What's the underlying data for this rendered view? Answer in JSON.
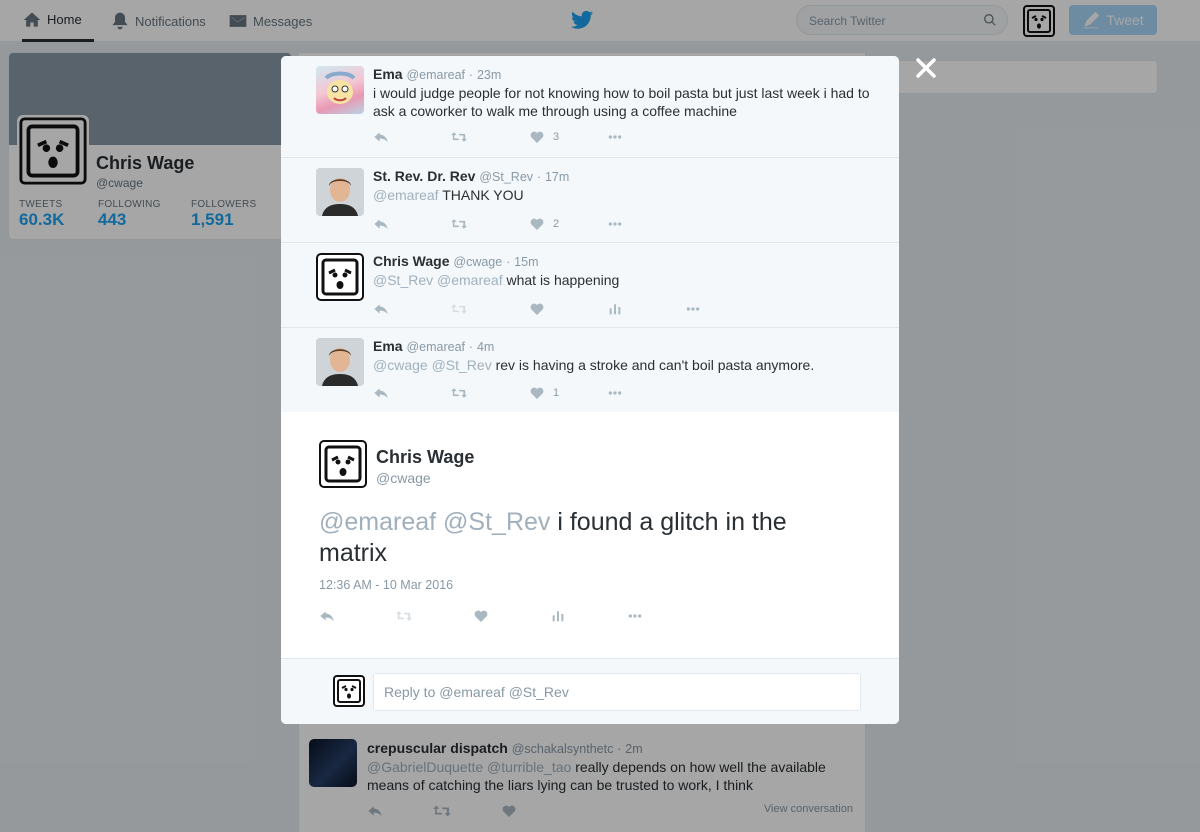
{
  "nav": {
    "home": "Home",
    "notifications": "Notifications",
    "messages": "Messages",
    "search_placeholder": "Search Twitter",
    "tweet_button": "Tweet"
  },
  "profile": {
    "name": "Chris Wage",
    "handle": "@cwage",
    "stats": [
      {
        "label": "TWEETS",
        "value": "60.3K"
      },
      {
        "label": "FOLLOWING",
        "value": "443"
      },
      {
        "label": "FOLLOWERS",
        "value": "1,591"
      }
    ]
  },
  "conversation": [
    {
      "name": "Ema",
      "handle": "@emareaf",
      "time": "23m",
      "mentions": "",
      "text": "i would judge people for not knowing how to boil pasta but just last  week i had to ask a coworker to walk me through using a coffee machine",
      "like_count": "3"
    },
    {
      "name": "St. Rev. Dr. Rev",
      "handle": "@St_Rev",
      "time": "17m",
      "mentions": "@emareaf",
      "text": "THANK YOU",
      "like_count": "2"
    },
    {
      "name": "Chris Wage",
      "handle": "@cwage",
      "time": "15m",
      "mentions": "@St_Rev @emareaf",
      "text": "what is happening",
      "like_count": ""
    },
    {
      "name": "Ema",
      "handle": "@emareaf",
      "time": "4m",
      "mentions": "@cwage @St_Rev",
      "text": "rev is having a stroke and can't boil pasta anymore.",
      "like_count": "1"
    }
  ],
  "main_tweet": {
    "name": "Chris Wage",
    "handle": "@cwage",
    "mentions": "@emareaf @St_Rev",
    "text": "i found a glitch in the matrix",
    "timestamp": "12:36 AM - 10 Mar 2016"
  },
  "reply": {
    "prefix": "Reply to",
    "mentions": "@emareaf @St_Rev"
  },
  "background_tweet": {
    "name": "crepuscular dispatch",
    "handle": "@schakalsynthetc",
    "time": "2m",
    "mentions": "@GabrielDuquette @turrible_tao",
    "text": "really depends on how well the available means of catching the liars lying can be trusted to work, I think",
    "view_conversation": "View conversation"
  },
  "colors": {
    "twitter_blue": "#1da1f2",
    "muted": "#8899a6",
    "modal_convo_bg": "#f5f8fa"
  }
}
